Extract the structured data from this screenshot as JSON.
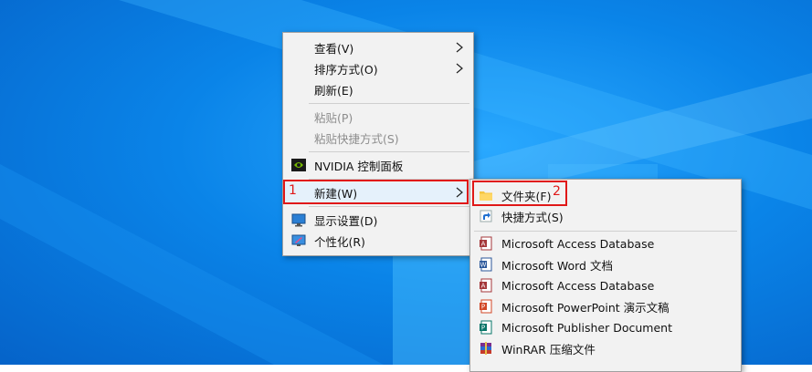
{
  "context_menu": {
    "view": "查看(V)",
    "sort": "排序方式(O)",
    "refresh": "刷新(E)",
    "paste": "粘贴(P)",
    "paste_shortcut": "粘贴快捷方式(S)",
    "nvidia": "NVIDIA 控制面板",
    "new": "新建(W)",
    "display": "显示设置(D)",
    "personalize": "个性化(R)"
  },
  "new_submenu": {
    "folder": "文件夹(F)",
    "shortcut": "快捷方式(S)",
    "items": [
      "Microsoft Access Database",
      "Microsoft Word 文档",
      "Microsoft Access Database",
      "Microsoft PowerPoint 演示文稿",
      "Microsoft Publisher Document",
      "WinRAR 压缩文件"
    ]
  },
  "annotations": {
    "step1": "1",
    "step2": "2"
  },
  "colors": {
    "highlight": "#e01818",
    "menu_bg": "#f2f2f2"
  }
}
